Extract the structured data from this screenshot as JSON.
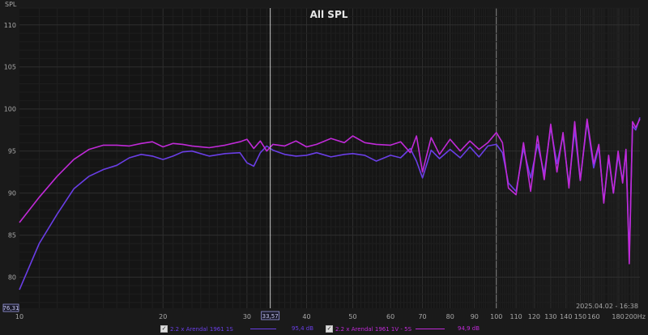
{
  "chart_data": {
    "type": "line",
    "title": "All SPL",
    "ylabel": "SPL",
    "x_unit": "Hz",
    "x_scale": "log",
    "xlim": [
      10,
      200
    ],
    "ylim": [
      76.3,
      112
    ],
    "grid": true,
    "x_major_ticks": [
      "10",
      "20",
      "30",
      "40",
      "50",
      "60",
      "70",
      "80",
      "90",
      "100",
      "110",
      "120",
      "130",
      "140",
      "150",
      "160",
      "180",
      "200Hz"
    ],
    "x_tick_values": [
      10,
      20,
      30,
      40,
      50,
      60,
      70,
      80,
      90,
      100,
      110,
      120,
      130,
      140,
      150,
      160,
      180,
      200
    ],
    "y_ticks": [
      80,
      85,
      90,
      95,
      100,
      105,
      110
    ],
    "cursor_x": 33.57,
    "cursor_x_label": "33,57",
    "y_cursor_label": "76,31",
    "timestamp": "2025.04.02 - 16:38",
    "series": [
      {
        "name": "2.2 x Arendal 1961 1S",
        "color": "#6a3ee6",
        "legend_value": "95,4 dB",
        "x": [
          10,
          11,
          12,
          13,
          14,
          15,
          16,
          17,
          18,
          19,
          20,
          21,
          22,
          23,
          25,
          27,
          29,
          30,
          31,
          32,
          33,
          34,
          36,
          38,
          40,
          42,
          45,
          48,
          50,
          53,
          56,
          60,
          63,
          66,
          68,
          70,
          73,
          76,
          80,
          84,
          88,
          92,
          96,
          100,
          103,
          106,
          110,
          114,
          118,
          122,
          126,
          130,
          134,
          138,
          142,
          146,
          150,
          155,
          160,
          164,
          168,
          172,
          176,
          180,
          184,
          187,
          190,
          193,
          196,
          200
        ],
        "y": [
          78.5,
          84,
          87.5,
          90.5,
          92,
          92.8,
          93.3,
          94.2,
          94.6,
          94.4,
          94,
          94.4,
          94.9,
          95,
          94.4,
          94.7,
          94.8,
          93.6,
          93.2,
          94.8,
          95.6,
          95.1,
          94.6,
          94.4,
          94.5,
          94.8,
          94.3,
          94.6,
          94.7,
          94.5,
          93.8,
          94.5,
          94.2,
          95.3,
          93.8,
          91.8,
          95.1,
          94.1,
          95.2,
          94.2,
          95.5,
          94.3,
          95.6,
          95.8,
          94.8,
          91.2,
          90.2,
          95.3,
          91.8,
          95.8,
          92.3,
          97.8,
          93.5,
          96.8,
          91.0,
          97.5,
          91.5,
          98.5,
          93.0,
          95.5,
          89.0,
          94.2,
          90.0,
          94.5,
          91.5,
          95.0,
          82.5,
          98.0,
          97.5,
          99.0
        ]
      },
      {
        "name": "2.2 x Arendal 1961 1V - 5S",
        "color": "#c02ad8",
        "legend_value": "94,9 dB",
        "x": [
          10,
          11,
          12,
          13,
          14,
          15,
          16,
          17,
          18,
          19,
          20,
          21,
          22,
          23,
          25,
          27,
          29,
          30,
          31,
          32,
          33,
          34,
          36,
          38,
          40,
          42,
          45,
          48,
          50,
          53,
          56,
          60,
          63,
          66,
          68,
          70,
          73,
          76,
          80,
          84,
          88,
          92,
          96,
          100,
          103,
          106,
          110,
          114,
          118,
          122,
          126,
          130,
          134,
          138,
          142,
          146,
          150,
          155,
          160,
          164,
          168,
          172,
          176,
          180,
          184,
          187,
          190,
          193,
          196,
          200
        ],
        "y": [
          86.5,
          89.5,
          92,
          94,
          95.2,
          95.7,
          95.7,
          95.6,
          95.9,
          96.1,
          95.5,
          95.9,
          95.8,
          95.6,
          95.4,
          95.7,
          96.1,
          96.4,
          95.3,
          96.2,
          95.0,
          95.8,
          95.6,
          96.2,
          95.5,
          95.8,
          96.5,
          96.0,
          96.8,
          96.0,
          95.8,
          95.7,
          96.1,
          94.8,
          96.8,
          92.5,
          96.6,
          94.6,
          96.4,
          95.0,
          96.2,
          95.2,
          96.0,
          97.2,
          96.0,
          90.6,
          89.8,
          96.0,
          90.2,
          96.8,
          91.6,
          98.2,
          92.5,
          97.2,
          90.6,
          98.5,
          91.5,
          98.8,
          93.5,
          95.8,
          88.8,
          94.5,
          90.0,
          95.0,
          91.2,
          95.2,
          81.6,
          98.5,
          97.8,
          98.8
        ]
      }
    ]
  }
}
